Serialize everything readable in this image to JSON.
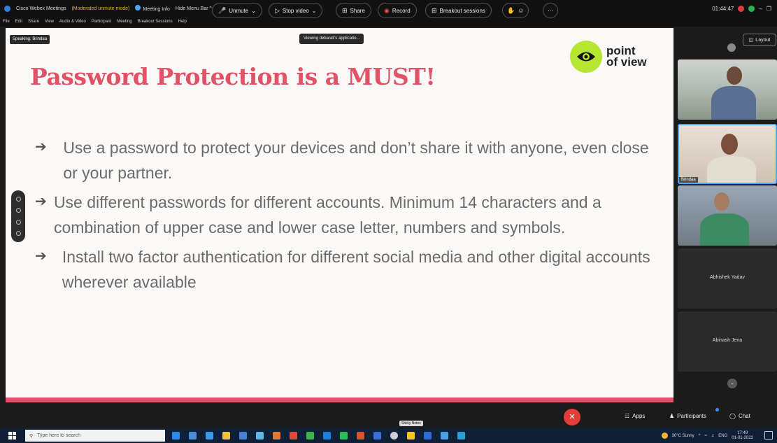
{
  "titlebar": {
    "app_name": "Cisco Webex Meetings",
    "moderated": "(Moderated unmute mode)",
    "meeting_info": "Meeting Info",
    "hide_menu": "Hide Menu Bar ^",
    "time": "01:44:47"
  },
  "menu": [
    "File",
    "Edit",
    "Share",
    "View",
    "Audio & Video",
    "Participant",
    "Meeting",
    "Breakout Sessions",
    "Help"
  ],
  "slide": {
    "speaking": "Speaking: Brindaa",
    "viewing": "Viewing debarati's applicatio...",
    "title": "Password Protection is a MUST!",
    "logo_line1": "point",
    "logo_line2": "of view",
    "bullets": [
      "Use a password to protect your devices and don’t share it with anyone, even close or your partner.",
      "Use different passwords for different accounts. Minimum 14 characters and a combination of upper case and lower case letter, numbers and symbols.",
      "Install two factor authentication for different social media and other digital accounts wherever available"
    ]
  },
  "panel": {
    "layout_label": "Layout",
    "tile2_name": "Brindaa",
    "tile4_name": "Abhishek Yadav",
    "tile5_name": "Abinash Jena"
  },
  "controls": {
    "unmute": "Unmute",
    "stop_video": "Stop video",
    "share": "Share",
    "record": "Record",
    "breakout": "Breakout sessions",
    "tooltip": "Sticky Notes",
    "apps": "Apps",
    "participants": "Participants",
    "chat": "Chat"
  },
  "taskbar": {
    "search_placeholder": "Type here to search",
    "weather": "30°C Sunny",
    "lang": "ENG",
    "time": "17:49",
    "date": "01-01-2022"
  },
  "colors": {
    "title_pink": "#e05266",
    "logo_green": "#b5e630",
    "end_red": "#e43b3b"
  }
}
